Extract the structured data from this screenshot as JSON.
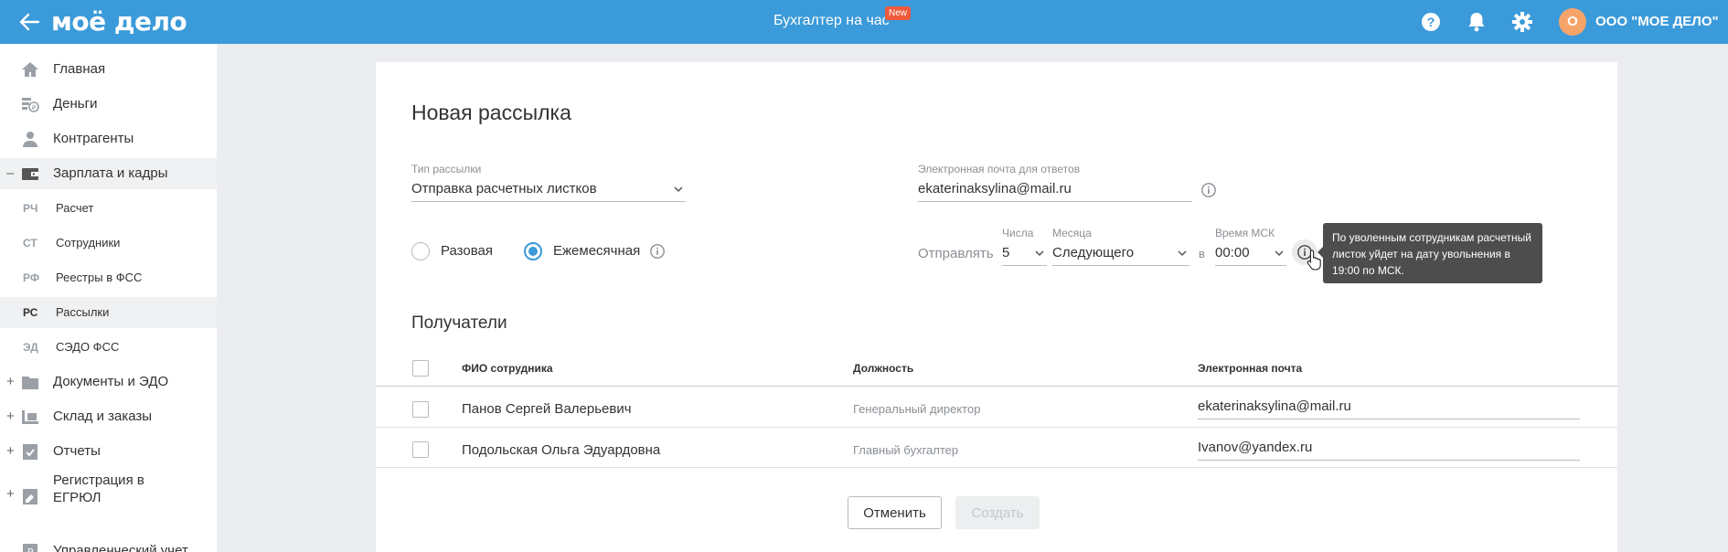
{
  "header": {
    "logo": "моё дело",
    "center_title": "Бухгалтер на час",
    "new_badge": "New",
    "avatar_letter": "О",
    "org_name": "ООО \"МОЕ ДЕЛО\"",
    "icons": [
      "back-arrow-icon",
      "help-icon",
      "bell-icon",
      "gear-icon"
    ]
  },
  "sidebar": {
    "items": [
      {
        "label": "Главная",
        "icon": "home-icon"
      },
      {
        "label": "Деньги",
        "icon": "money-icon"
      },
      {
        "label": "Контрагенты",
        "icon": "contractors-icon"
      },
      {
        "label": "Зарплата и кадры",
        "icon": "wallet-icon",
        "expander": "–"
      },
      {
        "label": "Документы и ЭДО",
        "icon": "documents-icon",
        "expander": "+"
      },
      {
        "label": "Склад и заказы",
        "icon": "warehouse-icon",
        "expander": "+"
      },
      {
        "label": "Отчеты",
        "icon": "reports-icon",
        "expander": "+"
      },
      {
        "label": "Регистрация в",
        "label2": "ЕГРЮЛ",
        "icon": "registration-icon",
        "expander": "+"
      },
      {
        "label": "Управленческий учет",
        "icon": "management-icon"
      }
    ],
    "sub_items": [
      {
        "abbr": "РЧ",
        "label": "Расчет"
      },
      {
        "abbr": "СТ",
        "label": "Сотрудники"
      },
      {
        "abbr": "РФ",
        "label": "Реестры в ФСС"
      },
      {
        "abbr": "РС",
        "label": "Рассылки"
      },
      {
        "abbr": "ЭД",
        "label": "СЭДО ФСС"
      }
    ]
  },
  "form": {
    "title": "Новая рассылка",
    "type_label": "Тип рассылки",
    "type_value": "Отправка расчетных листков",
    "email_label": "Электронная почта для ответов",
    "email_value": "ekaterinaksylina@mail.ru",
    "radio_once": "Разовая",
    "radio_monthly": "Ежемесячная",
    "send_label": "Отправлять",
    "day_label": "Числа",
    "day_value": "5",
    "month_label": "Месяца",
    "month_value": "Следующего",
    "at_label": "в",
    "time_label": "Время МСК",
    "time_value": "00:00",
    "tooltip": "По уволенным сотрудникам расчетный листок уйдет на дату увольнения в 19:00 по МСК."
  },
  "recipients": {
    "title": "Получатели",
    "columns": [
      "ФИО сотрудника",
      "Должность",
      "Электронная почта"
    ],
    "rows": [
      {
        "name": "Панов Сергей Валерьевич",
        "position": "Генеральный директор",
        "email": "ekaterinaksylina@mail.ru"
      },
      {
        "name": "Подольская Ольга Эдуардовна",
        "position": "Главный бухгалтер",
        "email": "Ivanov@yandex.ru"
      }
    ]
  },
  "buttons": {
    "cancel": "Отменить",
    "create": "Создать"
  },
  "colors": {
    "header": "#3b9ad9",
    "accent": "#3b9ad9",
    "badge": "#f05a3c",
    "avatar": "#f7a46a"
  }
}
